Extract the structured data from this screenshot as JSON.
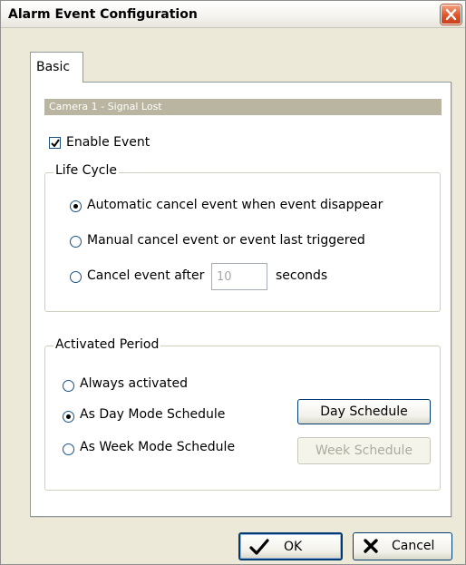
{
  "window": {
    "title": "Alarm Event Configuration",
    "close_icon": "close-x-icon"
  },
  "tabs": [
    {
      "label": "Basic",
      "selected": true
    }
  ],
  "camera_header": "Camera 1 - Signal Lost",
  "enable_event": {
    "label": "Enable Event",
    "checked": true
  },
  "life_cycle": {
    "title": "Life Cycle",
    "options": [
      {
        "label": "Automatic cancel event when event disappear",
        "selected": true
      },
      {
        "label": "Manual cancel event or event last triggered",
        "selected": false
      },
      {
        "label": "Cancel event after",
        "selected": false
      }
    ],
    "seconds_value": "10",
    "seconds_label": "seconds"
  },
  "activated_period": {
    "title": "Activated Period",
    "options": [
      {
        "label": "Always activated",
        "selected": false
      },
      {
        "label": "As Day Mode Schedule",
        "selected": true
      },
      {
        "label": "As Week Mode Schedule",
        "selected": false
      }
    ],
    "day_schedule_label": "Day Schedule",
    "week_schedule_label": "Week Schedule",
    "week_schedule_enabled": false
  },
  "footer": {
    "ok_label": "OK",
    "cancel_label": "Cancel",
    "ok_icon": "checkmark-icon",
    "cancel_icon": "x-mark-icon"
  },
  "colors": {
    "window_bg": "#ece9d8",
    "header_bar": "#b9b5a0",
    "close_button": "#e0542a",
    "focus_border": "#003c74"
  }
}
